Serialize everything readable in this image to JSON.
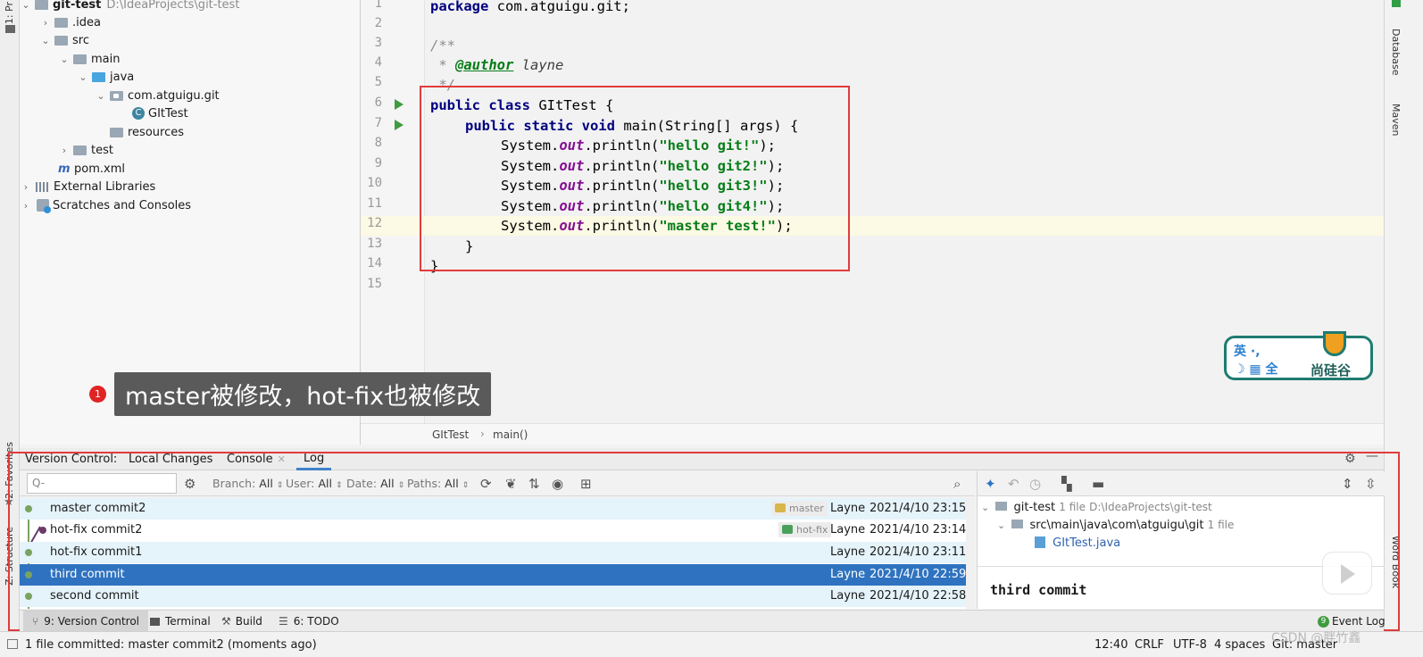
{
  "project": {
    "root_name": "git-test",
    "root_path": "D:\\IdeaProjects\\git-test",
    "items": [
      {
        "label": ".idea"
      },
      {
        "label": "src"
      },
      {
        "label": "main"
      },
      {
        "label": "java"
      },
      {
        "label": "com.atguigu.git"
      },
      {
        "label": "GItTest"
      },
      {
        "label": "resources"
      },
      {
        "label": "test"
      },
      {
        "label": "pom.xml"
      },
      {
        "label": "External Libraries"
      },
      {
        "label": "Scratches and Consoles"
      }
    ]
  },
  "left_stripe": {
    "project": "1: Pr",
    "favorites": "2: Favorites",
    "structure": "Z: Structure"
  },
  "right_stripe": {
    "database": "Database",
    "maven": "Maven",
    "wordbook": "Word Book"
  },
  "editor": {
    "line_numbers": [
      "1",
      "2",
      "3",
      "4",
      "5",
      "6",
      "7",
      "8",
      "9",
      "10",
      "11",
      "12",
      "13",
      "14",
      "15"
    ],
    "code": {
      "l1_kw": "package",
      "l1_rest": " com.atguigu.git;",
      "l3": "/**",
      "l4_star": " * ",
      "l4_tag": "@author",
      "l4_val": " layne",
      "l5": " */",
      "l6_kw": "public class",
      "l6_rest": " GItTest {",
      "l7_kw": "public static void",
      "l7_rest": " main(String[] args) {",
      "sys": "System.",
      "out": "out",
      "println": ".println(",
      "end": ");",
      "s8": "\"hello git!\"",
      "s9": "\"hello git2!\"",
      "s10": "\"hello git3!\"",
      "s11": "\"hello git4!\"",
      "s12": "\"master test!\"",
      "l13": "}",
      "l14": "}"
    },
    "breadcrumb_class": "GItTest",
    "breadcrumb_method": "main()"
  },
  "annotation": {
    "number": "1",
    "text": "master被修改，hot-fix也被修改"
  },
  "watermark": {
    "line1": "英 ·, ",
    "line2": "☽ ▦ 全",
    "brand": "尚硅谷"
  },
  "version_control": {
    "title": "Version Control:",
    "tabs": [
      "Local Changes",
      "Console",
      "Log"
    ],
    "active_tab": "Log",
    "search_placeholder": "Q-",
    "filters": {
      "branch_label": "Branch:",
      "branch_value": "All",
      "user_label": "User:",
      "user_value": "All",
      "date_label": "Date:",
      "date_value": "All",
      "paths_label": "Paths:",
      "paths_value": "All"
    },
    "commits": [
      {
        "message": "master commit2",
        "ref": "master",
        "author": "Layne",
        "date": "2021/4/10 23:15"
      },
      {
        "message": "hot-fix commit2",
        "ref": "hot-fix",
        "author": "Layne",
        "date": "2021/4/10 23:14"
      },
      {
        "message": "hot-fix commit1",
        "ref": "",
        "author": "Layne",
        "date": "2021/4/10 23:11"
      },
      {
        "message": "third commit",
        "ref": "",
        "author": "Layne",
        "date": "2021/4/10 22:59"
      },
      {
        "message": "second commit",
        "ref": "",
        "author": "Layne",
        "date": "2021/4/10 22:58"
      }
    ],
    "selected_commit": "third commit",
    "details": {
      "root": "git-test",
      "root_meta": "1 file",
      "root_path": "D:\\IdeaProjects\\git-test",
      "folder": "src\\main\\java\\com\\atguigu\\git",
      "folder_meta": "1 file",
      "file": "GItTest.java",
      "commit_title": "third commit"
    }
  },
  "bottom_tabs": [
    {
      "label": "9: Version Control"
    },
    {
      "label": "Terminal"
    },
    {
      "label": "Build"
    },
    {
      "label": "6: TODO"
    }
  ],
  "event_log": {
    "count": "9",
    "label": "Event Log"
  },
  "status_bar": {
    "message": "1 file committed: master commit2 (moments ago)",
    "position": "12:40",
    "line_sep": "CRLF",
    "encoding": "UTF-8",
    "indent": "4 spaces",
    "branch": "Git: master",
    "watermark": "CSDN @胖竹鑫"
  },
  "colors": {
    "accent": "#2f73c0",
    "red_highlight": "#e23b3b",
    "annotation_bg": "#5a5a5a"
  }
}
